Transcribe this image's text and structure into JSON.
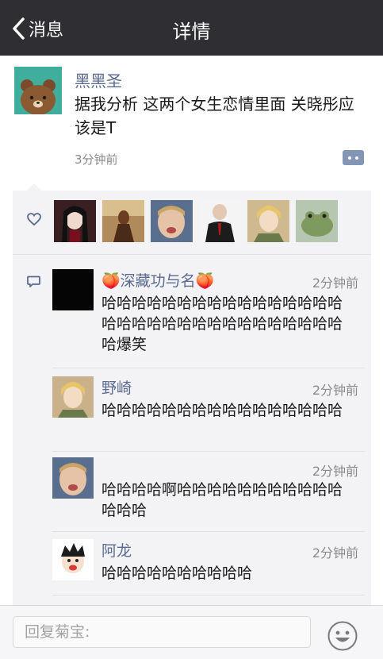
{
  "nav": {
    "back_label": "消息",
    "title": "详情"
  },
  "post": {
    "author": "黑黑圣",
    "text": "据我分析 这两个女生恋情里面 关晓彤应该是T",
    "time": "3分钟前"
  },
  "comments": [
    {
      "name": "🍑深藏功与名🍑",
      "time": "2分钟前",
      "text": "哈哈哈哈哈哈哈哈哈哈哈哈哈哈哈哈哈哈哈哈哈哈哈哈哈哈哈哈哈哈哈哈哈爆笑"
    },
    {
      "name": "野崎",
      "time": "2分钟前",
      "text": "哈哈哈哈哈哈哈哈哈哈哈哈哈哈哈哈"
    },
    {
      "name": "",
      "time": "2分钟前",
      "text": "哈哈哈哈啊哈哈哈哈哈哈哈哈哈哈哈哈哈哈"
    },
    {
      "name": "阿龙",
      "time": "2分钟前",
      "text": "哈哈哈哈哈哈哈哈哈哈"
    }
  ],
  "reply": {
    "placeholder": "回复菊宝:"
  },
  "colors": {
    "nav_bg": "#2e2e33",
    "name_link": "#5b6a91",
    "panel_bg": "#f3f3f5"
  }
}
